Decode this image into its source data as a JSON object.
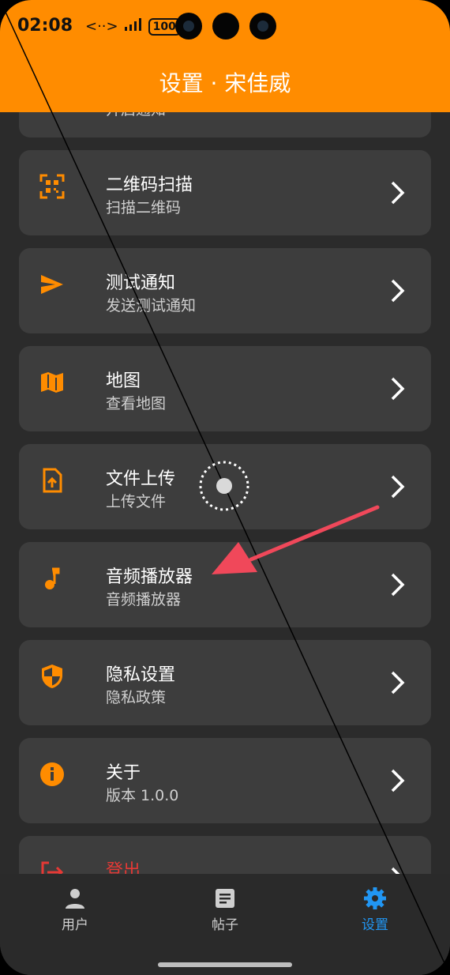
{
  "status": {
    "time": "02:08",
    "signal": "<··>",
    "battery": "100"
  },
  "appbar": {
    "title": "设置 · 宋佳威"
  },
  "partial_top": {
    "subtitle": "开启通知"
  },
  "items": [
    {
      "title": "二维码扫描",
      "subtitle": "扫描二维码",
      "icon": "qr-scan-icon"
    },
    {
      "title": "测试通知",
      "subtitle": "发送测试通知",
      "icon": "send-icon"
    },
    {
      "title": "地图",
      "subtitle": "查看地图",
      "icon": "map-icon"
    },
    {
      "title": "文件上传",
      "subtitle": "上传文件",
      "icon": "file-upload-icon"
    },
    {
      "title": "音频播放器",
      "subtitle": "音频播放器",
      "icon": "music-note-icon"
    },
    {
      "title": "隐私设置",
      "subtitle": "隐私政策",
      "icon": "privacy-shield-icon"
    },
    {
      "title": "关于",
      "subtitle": "版本 1.0.0",
      "icon": "info-icon"
    }
  ],
  "logout": {
    "title": "登出",
    "icon": "logout-icon"
  },
  "nav": {
    "users": {
      "label": "用户",
      "icon": "person-icon"
    },
    "posts": {
      "label": "帖子",
      "icon": "article-icon"
    },
    "settings": {
      "label": "设置",
      "icon": "gear-icon"
    }
  },
  "colors": {
    "accent": "#ff8c00",
    "active_nav": "#2196f3",
    "logout": "#e53935",
    "card": "#3d3d3d",
    "background": "#2b2b2b"
  }
}
